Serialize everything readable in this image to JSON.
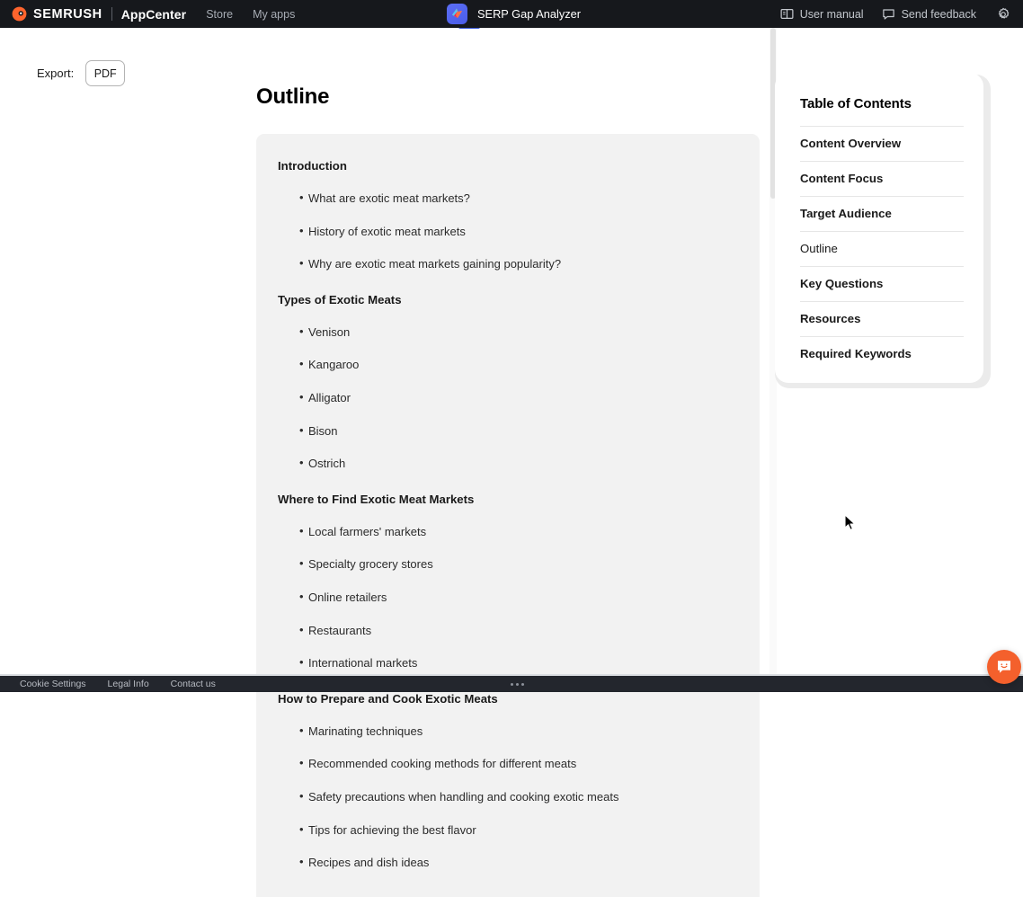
{
  "topnav": {
    "brand": "SEMRUSH",
    "product": "AppCenter",
    "links": [
      {
        "label": "Store"
      },
      {
        "label": "My apps"
      }
    ],
    "app_title": "SERP Gap Analyzer",
    "right_items": [
      {
        "label": "User manual",
        "icon": "book-icon"
      },
      {
        "label": "Send feedback",
        "icon": "chat-bubble-icon"
      }
    ],
    "settings_icon": "gear-icon"
  },
  "toolbar": {
    "export_label": "Export:",
    "pdf_label": "PDF"
  },
  "document": {
    "title": "Outline",
    "sections": [
      {
        "heading": "Introduction",
        "items": [
          "What are exotic meat markets?",
          "History of exotic meat markets",
          "Why are exotic meat markets gaining popularity?"
        ]
      },
      {
        "heading": "Types of Exotic Meats",
        "items": [
          "Venison",
          "Kangaroo",
          "Alligator",
          "Bison",
          "Ostrich"
        ]
      },
      {
        "heading": "Where to Find Exotic Meat Markets",
        "items": [
          "Local farmers' markets",
          "Specialty grocery stores",
          "Online retailers",
          "Restaurants",
          "International markets"
        ]
      },
      {
        "heading": "How to Prepare and Cook Exotic Meats",
        "items": [
          "Marinating techniques",
          "Recommended cooking methods for different meats",
          "Safety precautions when handling and cooking exotic meats",
          "Tips for achieving the best flavor",
          "Recipes and dish ideas"
        ]
      }
    ]
  },
  "toc": {
    "title": "Table of Contents",
    "items": [
      {
        "label": "Content Overview",
        "active": false
      },
      {
        "label": "Content Focus",
        "active": false
      },
      {
        "label": "Target Audience",
        "active": false
      },
      {
        "label": "Outline",
        "active": true
      },
      {
        "label": "Key Questions",
        "active": false
      },
      {
        "label": "Resources",
        "active": false
      },
      {
        "label": "Required Keywords",
        "active": false
      }
    ]
  },
  "footer": {
    "links": [
      {
        "label": "Cookie Settings"
      },
      {
        "label": "Legal Info"
      },
      {
        "label": "Contact us"
      }
    ],
    "more_icon": "ellipsis-icon"
  },
  "widgets": {
    "chat_icon": "intercom-chat-icon"
  },
  "colors": {
    "nav_bg": "#16181c",
    "footer_bg": "#23262d",
    "brand_orange": "#ff642d",
    "card_bg": "#f2f2f2",
    "chat_orange": "#f4602c",
    "app_icon_blue": "#5b6ef5"
  }
}
